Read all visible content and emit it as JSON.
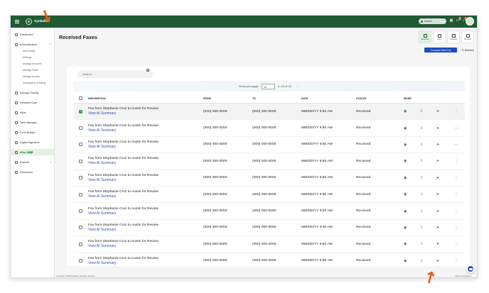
{
  "app": {
    "logo_text": "Synkwise"
  },
  "topbar": {
    "search_placeholder": "Search",
    "search_shortcut": "⌘ K",
    "icons": [
      "grid-icon",
      "message-icon",
      "bell-icon",
      "user-avatar"
    ],
    "notification_counts": [
      "8",
      "2"
    ]
  },
  "sidebar": {
    "items": [
      {
        "label": "Dashboard",
        "icon": "dashboard-icon"
      },
      {
        "label": "Administration",
        "icon": "admin-icon",
        "expanded": true,
        "children": [
          "Add Facility",
          "Settings",
          "Manage Accounts",
          "Manage Roles",
          "Manage Access",
          "Subscription & Billing"
        ]
      },
      {
        "label": "Manage Facility",
        "icon": "building-icon"
      },
      {
        "label": "Resident Care",
        "icon": "care-icon"
      },
      {
        "label": "eMar",
        "icon": "pill-icon"
      },
      {
        "label": "Task Manager",
        "icon": "task-icon"
      },
      {
        "label": "Form Builder",
        "icon": "form-icon"
      },
      {
        "label": "Digital Signature",
        "icon": "signature-icon"
      },
      {
        "label": "eFax",
        "icon": "fax-icon",
        "active": true,
        "badge": "NEW"
      },
      {
        "label": "Reports",
        "icon": "report-icon"
      },
      {
        "label": "Resources",
        "icon": "resources-icon"
      }
    ]
  },
  "page": {
    "title": "Received Faxes",
    "view_tabs": [
      {
        "label": "Received",
        "active": true
      },
      {
        "label": "Sent",
        "active": false
      },
      {
        "label": "Contacts",
        "active": false
      },
      {
        "label": "My eFax",
        "active": false
      }
    ],
    "compose_button": "Compose New Fax",
    "refresh_button": "Refresh",
    "search_placeholder": "Search",
    "items_per_page_label": "Items per page:",
    "items_per_page_value": "10",
    "range": "1–10 of 10"
  },
  "table": {
    "headers": [
      "DESCRIPTION",
      "FROM",
      "TO",
      "DATE",
      "STATUS",
      "MORE"
    ],
    "rows": [
      {
        "description": "Fax from Stephanie Cruz to Austin for Review",
        "summary": "View AI Summary",
        "from": "(000) 000-0000",
        "to": "(000) 000-0000",
        "date": "MM/DD/YY 9:50 AM",
        "status": "Received",
        "checked": true,
        "more": "⋮"
      },
      {
        "description": "Fax from Stephanie Cruz to Austin for Review",
        "summary": "View AI Summary",
        "from": "(000) 000-0000",
        "to": "(000) 000-0000",
        "date": "MM/DD/YY 9:50 AM",
        "status": "Received",
        "checked": false,
        "more": "⋯"
      },
      {
        "description": "Fax from Stephanie Cruz to Austin for Review",
        "summary": "View AI Summary",
        "from": "(000) 000-0000",
        "to": "(000) 000-0000",
        "date": "MM/DD/YY 9:50 AM",
        "status": "Received",
        "checked": false,
        "more": "⋯"
      },
      {
        "description": "Fax from Stephanie Cruz to Austin for Review",
        "summary": "View AI Summary",
        "from": "(000) 000-0000",
        "to": "(000) 000-0000",
        "date": "MM/DD/YY 9:50 AM",
        "status": "Received",
        "checked": false,
        "more": "⋮"
      },
      {
        "description": "Fax from Stephanie Cruz to Austin for Review",
        "summary": "View AI Summary",
        "from": "(000) 000-0000",
        "to": "(000) 000-0000",
        "date": "MM/DD/YY 9:50 AM",
        "status": "Received",
        "checked": false,
        "more": "⋮"
      },
      {
        "description": "Fax from Stephanie Cruz to Austin for Review",
        "summary": "View AI Summary",
        "from": "(000) 000-0000",
        "to": "(000) 000-0000",
        "date": "MM/DD/YY 9:50 AM",
        "status": "Received",
        "checked": false,
        "more": "⋮"
      },
      {
        "description": "Fax from Stephanie Cruz to Austin for Review",
        "summary": "View AI Summary",
        "from": "(000) 000-0000",
        "to": "(000) 000-0000",
        "date": "MM/DD/YY 9:50 AM",
        "status": "Received",
        "checked": false,
        "more": "⋮"
      },
      {
        "description": "Fax from Stephanie Cruz to Austin for Review",
        "summary": "View AI Summary",
        "from": "(000) 000-0000",
        "to": "(000) 000-0000",
        "date": "MM/DD/YY 9:50 AM",
        "status": "Received",
        "checked": false,
        "more": "⋮"
      },
      {
        "description": "Fax from Stephanie Cruz to Austin for Review",
        "summary": "View AI Summary",
        "from": "(000) 000-0000",
        "to": "(000) 000-0000",
        "date": "MM/DD/YY 9:50 AM",
        "status": "Received",
        "checked": false,
        "more": "⋮"
      },
      {
        "description": "Fax from Stephanie Cruz to Austin for Review",
        "summary": "View AI Summary",
        "from": "(000) 000-0000",
        "to": "(000) 000-0000",
        "date": "MM/DD/YY 9:50 AM",
        "status": "Received",
        "checked": false,
        "more": "⋮"
      }
    ]
  },
  "footer": {
    "copyright": "Copyright © 2025 Synkwise. All rights reserved.",
    "links": "Terms & Conditions"
  },
  "colors": {
    "brand": "#1f5a34",
    "accent": "#1d4abf",
    "annotation": "#e45d19"
  }
}
